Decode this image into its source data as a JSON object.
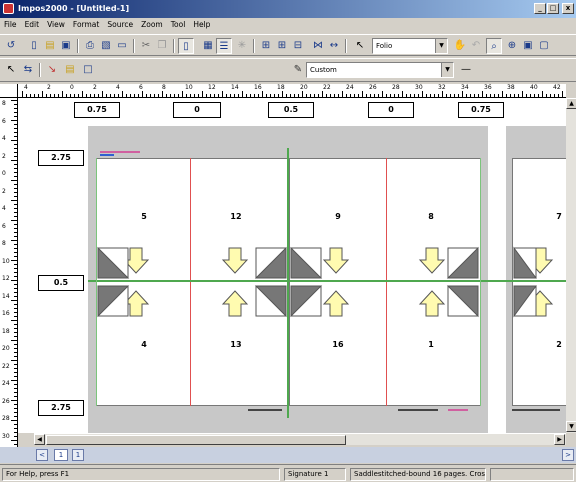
{
  "window": {
    "title": "Impos2000 - [Untitled-1]",
    "minimize": "_",
    "restore": "□",
    "close": "x"
  },
  "menu": [
    "File",
    "Edit",
    "View",
    "Format",
    "Source",
    "Zoom",
    "Tool",
    "Help"
  ],
  "toolbar": {
    "layout_combo": "Folio",
    "style_combo": "Custom",
    "style_minus": "—"
  },
  "margins": {
    "top": [
      "0.75",
      "0",
      "0.5",
      "0",
      "0.75"
    ],
    "left": [
      "2.75",
      "0.5",
      "2.75"
    ]
  },
  "ruler": {
    "h_labels": [
      "4",
      "2",
      "0",
      "2",
      "4",
      "6",
      "8",
      "10",
      "12",
      "14",
      "16",
      "18",
      "20",
      "22",
      "24",
      "26",
      "28",
      "30",
      "32",
      "34",
      "36",
      "38",
      "40",
      "42"
    ],
    "v_labels": [
      "8",
      "6",
      "4",
      "2",
      "0",
      "2",
      "4",
      "6",
      "8",
      "10",
      "12",
      "14",
      "16",
      "18",
      "20",
      "22",
      "24",
      "26",
      "28",
      "30"
    ]
  },
  "pages": {
    "top_row": [
      "5",
      "12",
      "9",
      "8",
      "7"
    ],
    "bottom_row": [
      "4",
      "13",
      "16",
      "1",
      "2"
    ]
  },
  "tabs": {
    "prev": "<",
    "signature_tab": "1",
    "next": ">"
  },
  "status": {
    "help": "For Help, press F1",
    "signature": "Signature 1",
    "description": "Saddlestitched-bound 16 pages. Cros"
  }
}
